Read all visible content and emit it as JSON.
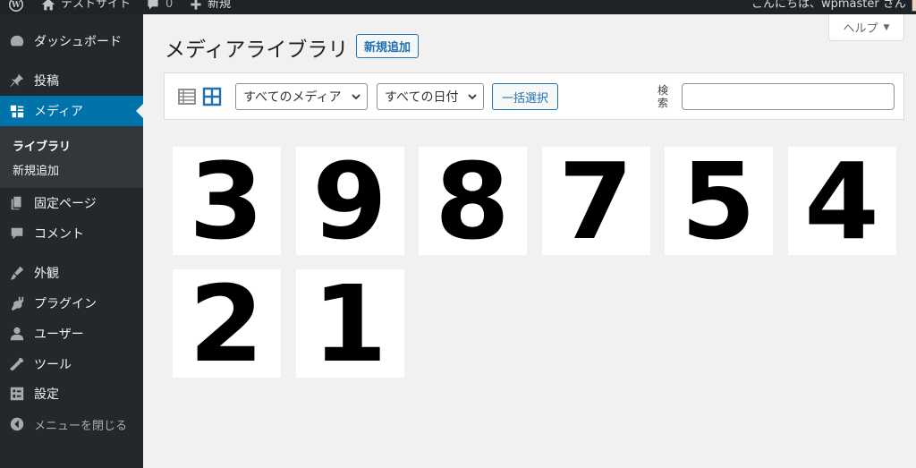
{
  "admin_bar": {
    "site_name": "テストサイト",
    "comments_count": "0",
    "new_label": "新規",
    "greeting": "こんにちは、wpmaster さん"
  },
  "sidebar": {
    "items": [
      {
        "label": "ダッシュボード",
        "icon": "dashboard-icon"
      },
      {
        "label": "投稿",
        "icon": "pushpin-icon"
      },
      {
        "label": "メディア",
        "icon": "media-icon"
      },
      {
        "label": "固定ページ",
        "icon": "page-icon"
      },
      {
        "label": "コメント",
        "icon": "comment-icon"
      },
      {
        "label": "外観",
        "icon": "brush-icon"
      },
      {
        "label": "プラグイン",
        "icon": "plugin-icon"
      },
      {
        "label": "ユーザー",
        "icon": "user-icon"
      },
      {
        "label": "ツール",
        "icon": "wrench-icon"
      },
      {
        "label": "設定",
        "icon": "settings-icon"
      }
    ],
    "submenu": [
      "ライブラリ",
      "新規追加"
    ],
    "collapse_label": "メニューを閉じる"
  },
  "header": {
    "title": "メディアライブラリ",
    "add_new_label": "新規追加",
    "help_label": "ヘルプ"
  },
  "toolbar": {
    "filter_type": "すべてのメディア",
    "filter_date": "すべての日付",
    "bulk_select_label": "一括選択",
    "search_label": "検索",
    "search_value": ""
  },
  "colors": {
    "sidebar_bg": "#23282d",
    "accent": "#0073aa",
    "admin_bar": "#1d2327"
  },
  "media": [
    {
      "label": "3"
    },
    {
      "label": "9"
    },
    {
      "label": "8"
    },
    {
      "label": "7"
    },
    {
      "label": "5"
    },
    {
      "label": "4"
    },
    {
      "label": "2"
    },
    {
      "label": "1"
    }
  ]
}
